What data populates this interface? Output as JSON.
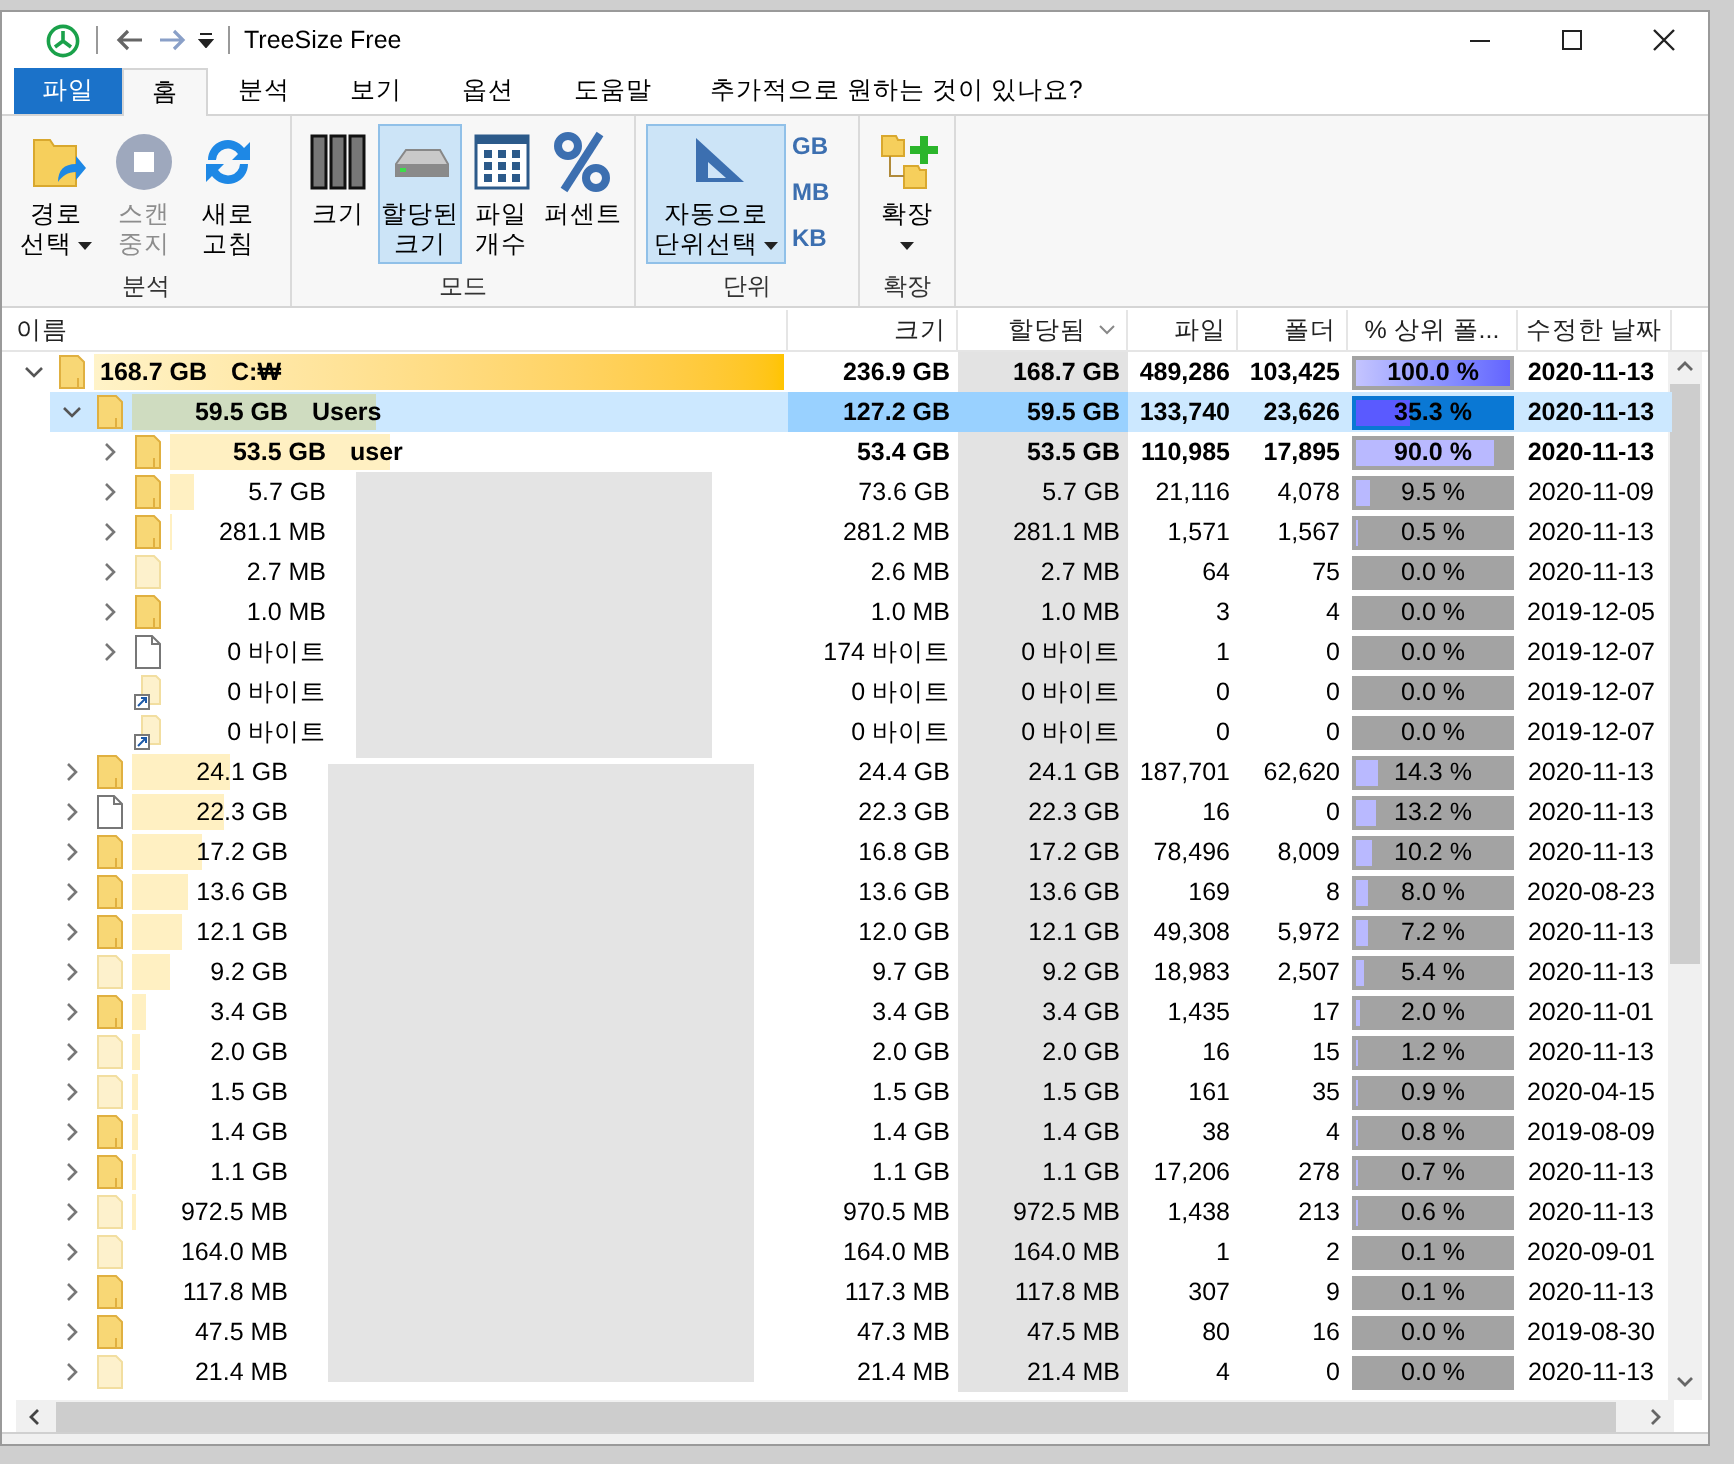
{
  "window": {
    "title": "TreeSize Free"
  },
  "tabs": [
    {
      "label": "파일",
      "kind": "file",
      "selected": false
    },
    {
      "label": "홈",
      "kind": "tab",
      "selected": true
    },
    {
      "label": "분석",
      "kind": "tab",
      "selected": false
    },
    {
      "label": "보기",
      "kind": "tab",
      "selected": false
    },
    {
      "label": "옵션",
      "kind": "tab",
      "selected": false
    },
    {
      "label": "도움말",
      "kind": "tab",
      "selected": false
    }
  ],
  "tell_me": "추가적으로 원하는 것이 있나요?",
  "ribbon": {
    "groups": [
      {
        "label": "분석",
        "buttons": [
          {
            "kind": "large",
            "lines": [
              "경로",
              "선택"
            ],
            "dropdown": true,
            "disabled": false,
            "selected": false
          },
          {
            "kind": "large",
            "lines": [
              "스캔",
              "중지"
            ],
            "dropdown": false,
            "disabled": true,
            "selected": false
          },
          {
            "kind": "large",
            "lines": [
              "새로",
              "고침"
            ],
            "dropdown": false,
            "disabled": false,
            "selected": false
          }
        ]
      },
      {
        "label": "모드",
        "buttons": [
          {
            "kind": "large",
            "lines": [
              "크기"
            ],
            "dropdown": false,
            "disabled": false,
            "selected": false
          },
          {
            "kind": "large",
            "lines": [
              "할당된",
              "크기"
            ],
            "dropdown": false,
            "disabled": false,
            "selected": true
          },
          {
            "kind": "large",
            "lines": [
              "파일",
              "개수"
            ],
            "dropdown": false,
            "disabled": false,
            "selected": false
          },
          {
            "kind": "large",
            "lines": [
              "퍼센트"
            ],
            "dropdown": false,
            "disabled": false,
            "selected": false
          }
        ]
      },
      {
        "label": "단위",
        "buttons": [
          {
            "kind": "large",
            "lines": [
              "자동으로",
              "단위선택"
            ],
            "dropdown": true,
            "disabled": false,
            "selected": true
          },
          {
            "kind": "small",
            "lines": [
              "GB"
            ],
            "dropdown": false,
            "disabled": false,
            "selected": false
          },
          {
            "kind": "small",
            "lines": [
              "MB"
            ],
            "dropdown": false,
            "disabled": false,
            "selected": false
          },
          {
            "kind": "small",
            "lines": [
              "KB"
            ],
            "dropdown": false,
            "disabled": false,
            "selected": false
          }
        ]
      },
      {
        "label": "확장",
        "buttons": [
          {
            "kind": "large",
            "lines": [
              "확장"
            ],
            "dropdown": true,
            "disabled": false,
            "selected": false
          }
        ]
      }
    ]
  },
  "table": {
    "columns": [
      {
        "label": "이름",
        "sorted": false
      },
      {
        "label": "크기",
        "sorted": false
      },
      {
        "label": "할당됨",
        "sorted": true
      },
      {
        "label": "파일",
        "sorted": false
      },
      {
        "label": "폴더",
        "sorted": false
      },
      {
        "label": "% 상위 폴...",
        "sorted": false
      },
      {
        "label": "수정한 날짜",
        "sorted": false
      }
    ],
    "rows": [
      {
        "kind": "folder",
        "size": "168.7 GB",
        "name": "C:₩",
        "total": "236.9 GB",
        "allocated": "168.7 GB",
        "files": "489,286",
        "folders": "103,425",
        "percent": "100.0 %",
        "level": 1.0,
        "date": "2020-11-13",
        "expandable": true,
        "expanded": true,
        "selected": false,
        "bold": true,
        "children": [
          {
            "kind": "folder",
            "size": "59.5 GB",
            "name": "Users",
            "total": "127.2 GB",
            "allocated": "59.5 GB",
            "files": "133,740",
            "folders": "23,626",
            "percent": "35.3 %",
            "level": 0.353,
            "date": "2020-11-13",
            "expandable": true,
            "expanded": true,
            "selected": true,
            "bold": true,
            "children": [
              {
                "kind": "folder",
                "size": "53.5 GB",
                "name": "user",
                "total": "53.4 GB",
                "allocated": "53.5 GB",
                "files": "110,985",
                "folders": "17,895",
                "percent": "90.0 %",
                "level": 0.9,
                "date": "2020-11-13",
                "expandable": true,
                "expanded": false,
                "selected": false,
                "bold": true
              },
              {
                "kind": "folder",
                "size": "5.7 GB",
                "total": "73.6 GB",
                "allocated": "5.7 GB",
                "files": "21,116",
                "folders": "4,078",
                "percent": "9.5 %",
                "level": 0.095,
                "date": "2020-11-09",
                "expandable": true,
                "expanded": false,
                "selected": false,
                "bold": false
              },
              {
                "kind": "folder",
                "size": "281.1 MB",
                "total": "281.2 MB",
                "allocated": "281.1 MB",
                "files": "1,571",
                "folders": "1,567",
                "percent": "0.5 %",
                "level": 0.005,
                "date": "2020-11-13",
                "expandable": true,
                "expanded": false,
                "selected": false,
                "bold": false
              },
              {
                "kind": "hidden-folder",
                "size": "2.7 MB",
                "total": "2.6 MB",
                "allocated": "2.7 MB",
                "files": "64",
                "folders": "75",
                "percent": "0.0 %",
                "level": 0.0,
                "date": "2020-11-13",
                "expandable": true,
                "expanded": false,
                "selected": false,
                "bold": false
              },
              {
                "kind": "folder",
                "size": "1.0 MB",
                "total": "1.0 MB",
                "allocated": "1.0 MB",
                "files": "3",
                "folders": "4",
                "percent": "0.0 %",
                "level": 0.0,
                "date": "2019-12-05",
                "expandable": true,
                "expanded": false,
                "selected": false,
                "bold": false
              },
              {
                "kind": "file",
                "size": "0 바이트",
                "total": "174 바이트",
                "allocated": "0 바이트",
                "files": "1",
                "folders": "0",
                "percent": "0.0 %",
                "level": 0.0,
                "date": "2019-12-07",
                "expandable": true,
                "expanded": false,
                "selected": false,
                "bold": false
              },
              {
                "kind": "shortcut",
                "size": "0 바이트",
                "total": "0 바이트",
                "allocated": "0 바이트",
                "files": "0",
                "folders": "0",
                "percent": "0.0 %",
                "level": 0.0,
                "date": "2019-12-07",
                "expandable": false,
                "selected": false,
                "bold": false
              },
              {
                "kind": "shortcut",
                "size": "0 바이트",
                "total": "0 바이트",
                "allocated": "0 바이트",
                "files": "0",
                "folders": "0",
                "percent": "0.0 %",
                "level": 0.0,
                "date": "2019-12-07",
                "expandable": false,
                "selected": false,
                "bold": false
              }
            ]
          },
          {
            "kind": "folder",
            "size": "24.1 GB",
            "total": "24.4 GB",
            "allocated": "24.1 GB",
            "files": "187,701",
            "folders": "62,620",
            "percent": "14.3 %",
            "level": 0.143,
            "date": "2020-11-13",
            "expandable": true,
            "expanded": false,
            "selected": false,
            "bold": false
          },
          {
            "kind": "file",
            "size": "22.3 GB",
            "total": "22.3 GB",
            "allocated": "22.3 GB",
            "files": "16",
            "folders": "0",
            "percent": "13.2 %",
            "level": 0.132,
            "date": "2020-11-13",
            "expandable": true,
            "expanded": false,
            "selected": false,
            "bold": false
          },
          {
            "kind": "folder",
            "size": "17.2 GB",
            "total": "16.8 GB",
            "allocated": "17.2 GB",
            "files": "78,496",
            "folders": "8,009",
            "percent": "10.2 %",
            "level": 0.102,
            "date": "2020-11-13",
            "expandable": true,
            "expanded": false,
            "selected": false,
            "bold": false
          },
          {
            "kind": "folder",
            "size": "13.6 GB",
            "total": "13.6 GB",
            "allocated": "13.6 GB",
            "files": "169",
            "folders": "8",
            "percent": "8.0 %",
            "level": 0.08,
            "date": "2020-08-23",
            "expandable": true,
            "expanded": false,
            "selected": false,
            "bold": false
          },
          {
            "kind": "folder",
            "size": "12.1 GB",
            "total": "12.0 GB",
            "allocated": "12.1 GB",
            "files": "49,308",
            "folders": "5,972",
            "percent": "7.2 %",
            "level": 0.072,
            "date": "2020-11-13",
            "expandable": true,
            "expanded": false,
            "selected": false,
            "bold": false
          },
          {
            "kind": "hidden-folder",
            "size": "9.2 GB",
            "total": "9.7 GB",
            "allocated": "9.2 GB",
            "files": "18,983",
            "folders": "2,507",
            "percent": "5.4 %",
            "level": 0.054,
            "date": "2020-11-13",
            "expandable": true,
            "expanded": false,
            "selected": false,
            "bold": false
          },
          {
            "kind": "folder",
            "size": "3.4 GB",
            "total": "3.4 GB",
            "allocated": "3.4 GB",
            "files": "1,435",
            "folders": "17",
            "percent": "2.0 %",
            "level": 0.02,
            "date": "2020-11-01",
            "expandable": true,
            "expanded": false,
            "selected": false,
            "bold": false
          },
          {
            "kind": "hidden-folder",
            "size": "2.0 GB",
            "total": "2.0 GB",
            "allocated": "2.0 GB",
            "files": "16",
            "folders": "15",
            "percent": "1.2 %",
            "level": 0.012,
            "date": "2020-11-13",
            "expandable": true,
            "expanded": false,
            "selected": false,
            "bold": false
          },
          {
            "kind": "hidden-folder",
            "size": "1.5 GB",
            "total": "1.5 GB",
            "allocated": "1.5 GB",
            "files": "161",
            "folders": "35",
            "percent": "0.9 %",
            "level": 0.009,
            "date": "2020-04-15",
            "expandable": true,
            "expanded": false,
            "selected": false,
            "bold": false
          },
          {
            "kind": "folder",
            "size": "1.4 GB",
            "total": "1.4 GB",
            "allocated": "1.4 GB",
            "files": "38",
            "folders": "4",
            "percent": "0.8 %",
            "level": 0.008,
            "date": "2019-08-09",
            "expandable": true,
            "expanded": false,
            "selected": false,
            "bold": false
          },
          {
            "kind": "folder",
            "size": "1.1 GB",
            "total": "1.1 GB",
            "allocated": "1.1 GB",
            "files": "17,206",
            "folders": "278",
            "percent": "0.7 %",
            "level": 0.007,
            "date": "2020-11-13",
            "expandable": true,
            "expanded": false,
            "selected": false,
            "bold": false
          },
          {
            "kind": "hidden-folder",
            "size": "972.5 MB",
            "total": "970.5 MB",
            "allocated": "972.5 MB",
            "files": "1,438",
            "folders": "213",
            "percent": "0.6 %",
            "level": 0.006,
            "date": "2020-11-13",
            "expandable": true,
            "expanded": false,
            "selected": false,
            "bold": false
          },
          {
            "kind": "hidden-folder",
            "size": "164.0 MB",
            "total": "164.0 MB",
            "allocated": "164.0 MB",
            "files": "1",
            "folders": "2",
            "percent": "0.1 %",
            "level": 0.001,
            "date": "2020-09-01",
            "expandable": true,
            "expanded": false,
            "selected": false,
            "bold": false
          },
          {
            "kind": "folder",
            "size": "117.8 MB",
            "total": "117.3 MB",
            "allocated": "117.8 MB",
            "files": "307",
            "folders": "9",
            "percent": "0.1 %",
            "level": 0.001,
            "date": "2020-11-13",
            "expandable": true,
            "expanded": false,
            "selected": false,
            "bold": false
          },
          {
            "kind": "folder",
            "size": "47.5 MB",
            "total": "47.3 MB",
            "allocated": "47.5 MB",
            "files": "80",
            "folders": "16",
            "percent": "0.0 %",
            "level": 0.0,
            "date": "2019-08-30",
            "expandable": true,
            "expanded": false,
            "selected": false,
            "bold": false
          },
          {
            "kind": "hidden-folder",
            "size": "21.4 MB",
            "total": "21.4 MB",
            "allocated": "21.4 MB",
            "files": "4",
            "folders": "0",
            "percent": "0.0 %",
            "level": 0.0,
            "date": "2020-11-13",
            "expandable": true,
            "expanded": false,
            "selected": false,
            "bold": false
          }
        ]
      }
    ]
  }
}
